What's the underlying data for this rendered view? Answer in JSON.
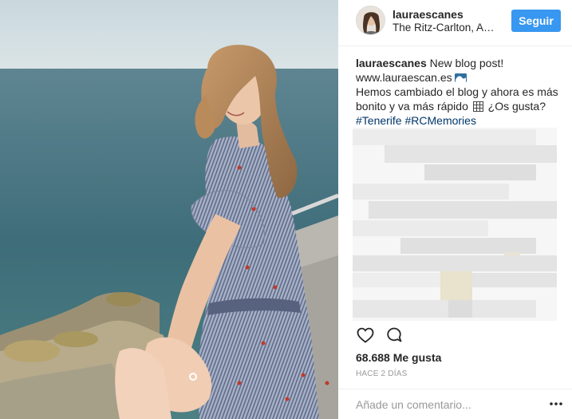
{
  "post": {
    "image_icon": "photo-woman-seaside",
    "author": {
      "username": "lauraescanes",
      "location": "The Ritz-Carlton, A…",
      "avatar_icon": "avatar-photo"
    },
    "follow_label": "Seguir",
    "caption": {
      "username": "lauraescanes",
      "text_1": "New blog post!",
      "text_2": "www.lauraescan.es",
      "text_3": "Hemos cambiado el blog y ahora es más bonito y va más rápido",
      "text_4": "¿Os gusta?",
      "hashtag_1": "#Tenerife",
      "hashtag_2": "#RCMemories"
    },
    "likes_text": "68.688 Me gusta",
    "timestamp": "HACE 2 DÍAS",
    "comment_placeholder": "Añade un comentario...",
    "icons": {
      "like": "heart-icon",
      "comment": "comment-icon",
      "more": "more-options-icon"
    }
  },
  "colors": {
    "follow_button": "#3897f0",
    "hashtag": "#003569",
    "text": "#262626",
    "muted": "#999999"
  }
}
